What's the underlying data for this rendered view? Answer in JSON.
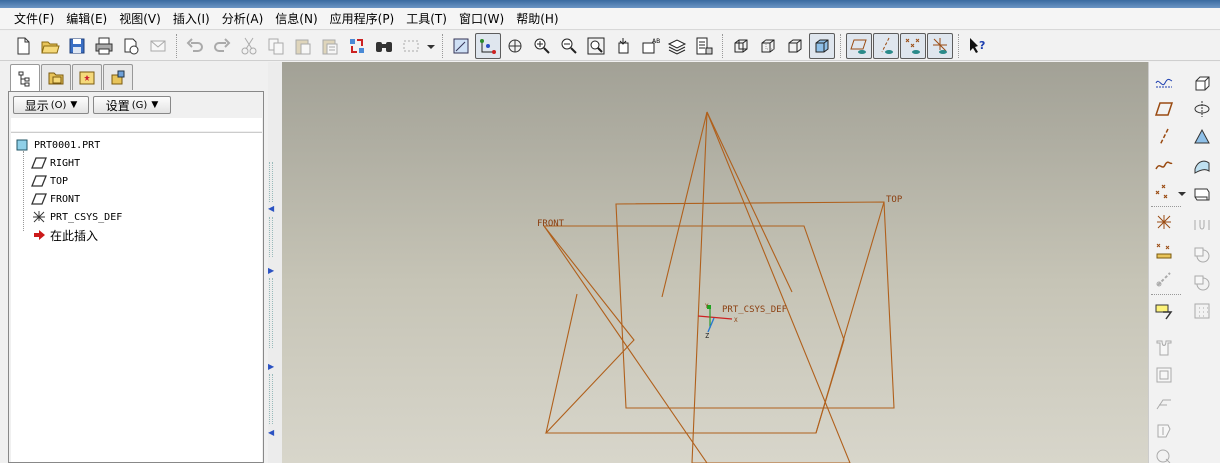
{
  "menu": [
    "文件(F)",
    "编辑(E)",
    "视图(V)",
    "插入(I)",
    "分析(A)",
    "信息(N)",
    "应用程序(P)",
    "工具(T)",
    "窗口(W)",
    "帮助(H)"
  ],
  "toolbar": {
    "icons": [
      "new-file-icon",
      "open-file-icon",
      "save-icon",
      "print-icon",
      "send-icon",
      "email-icon",
      "undo-icon",
      "redo-icon",
      "cut-icon",
      "copy-icon",
      "paste-icon",
      "paste-special-icon",
      "regenerate-icon",
      "find-icon",
      "select-box-icon",
      "repaint-icon",
      "spin-center-icon",
      "orient-icon",
      "zoom-in-icon",
      "zoom-out-icon",
      "refit-icon",
      "reorient-icon",
      "saved-views-icon",
      "layers-icon",
      "view-manager-icon",
      "wireframe-icon",
      "hidden-line-icon",
      "no-hidden-icon",
      "shading-icon",
      "datum-planes-toggle-icon",
      "datum-axes-toggle-icon",
      "datum-points-toggle-icon",
      "csys-toggle-icon",
      "context-help-icon"
    ]
  },
  "navigator": {
    "tabs": [
      "model-tree-icon",
      "folder-browser-icon",
      "favorites-icon",
      "connections-icon"
    ],
    "show_label": "显示",
    "show_key": "(O)",
    "settings_label": "设置",
    "settings_key": "(G)",
    "tree": {
      "root": "PRT0001.PRT",
      "items": [
        {
          "label": "RIGHT",
          "icon": "datum-plane-icon"
        },
        {
          "label": "TOP",
          "icon": "datum-plane-icon"
        },
        {
          "label": "FRONT",
          "icon": "datum-plane-icon"
        },
        {
          "label": "PRT_CSYS_DEF",
          "icon": "csys-icon"
        },
        {
          "label": "在此插入",
          "icon": "insert-here-arrow-icon"
        }
      ]
    }
  },
  "graphics": {
    "labels": {
      "front": "FRONT",
      "top": "TOP",
      "csys": "PRT_CSYS_DEF",
      "axis_x": "X",
      "axis_y": "Y",
      "axis_z": "Z"
    },
    "datum_color": "#b0601c",
    "background_top": "#a2a196",
    "background_bottom": "#d8d6cb"
  },
  "rightbar": {
    "icons": [
      "sketched-datum-curve-icon",
      "datum-plane-tool-icon",
      "datum-axis-tool-icon",
      "datum-curve-tool-icon",
      "datum-point-tool-icon",
      "csys-tool-icon",
      "analysis-feature-icon",
      "note-icon",
      "extrude-icon",
      "revolve-icon",
      "variable-section-sweep-icon",
      "blend-icon",
      "boundary-blend-icon",
      "hole-icon",
      "shell-icon",
      "rib-icon",
      "draft-icon",
      "round-icon",
      "chamfer-icon",
      "pattern-icon",
      "mirror-icon",
      "merge-icon",
      "trim-icon"
    ]
  }
}
